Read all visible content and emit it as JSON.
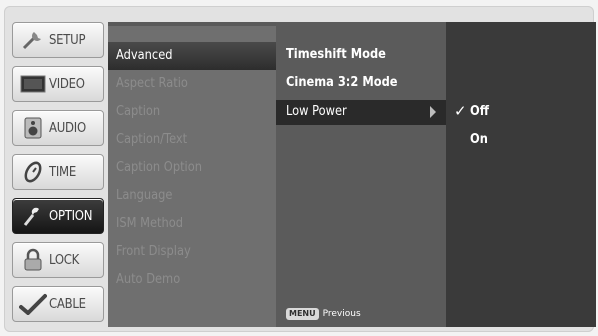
{
  "tabs": [
    {
      "label": "SETUP",
      "icon": "setup-icon"
    },
    {
      "label": "VIDEO",
      "icon": "video-icon"
    },
    {
      "label": "AUDIO",
      "icon": "audio-icon"
    },
    {
      "label": "TIME",
      "icon": "time-icon"
    },
    {
      "label": "OPTION",
      "icon": "option-icon",
      "active": true
    },
    {
      "label": "LOCK",
      "icon": "lock-icon"
    },
    {
      "label": "CABLE",
      "icon": "cable-icon"
    }
  ],
  "menu": {
    "items": [
      "Advanced",
      "Aspect Ratio",
      "Caption",
      "Caption/Text",
      "Caption Option",
      "Language",
      "ISM Method",
      "Front Display",
      "Auto Demo"
    ],
    "selected": "Advanced"
  },
  "submenu": {
    "items": [
      "Timeshift Mode",
      "Cinema 3:2 Mode",
      "Low Power"
    ],
    "highlighted": "Low Power"
  },
  "options": {
    "items": [
      "Off",
      "On"
    ],
    "checked": "Off",
    "check_mark": "✓"
  },
  "footer": {
    "button": "MENU",
    "label": "Previous"
  },
  "colors": {
    "active_tab": "#1c1c1c",
    "panel": "#6a6a6a",
    "highlight": "#2a2a2a"
  }
}
